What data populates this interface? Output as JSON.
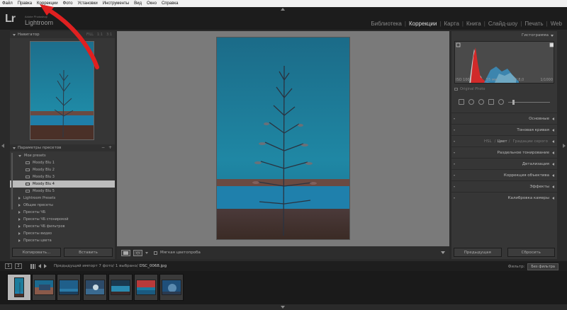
{
  "menu": [
    "Файл",
    "Правка",
    "Коррекции",
    "Фото",
    "Установки",
    "Инструменты",
    "Вид",
    "Окно",
    "Справка"
  ],
  "app": {
    "logo": "Lr",
    "subtitle": "Adobe Photoshop",
    "name": "Lightroom"
  },
  "modules": [
    "Библиотека",
    "Коррекции",
    "Карта",
    "Книга",
    "Слайд-шоу",
    "Печать",
    "Web"
  ],
  "active_module": "Коррекции",
  "navigator": {
    "title": "Навигатор",
    "zoom": [
      "FILL",
      "1:1",
      "3:1"
    ]
  },
  "presets": {
    "title": "Параметры пресетов",
    "add": "+",
    "remove": "−",
    "open_folder": "Мои presets",
    "items": [
      "Moody Blu 1",
      "Moody Blu 2",
      "Moody Blu 3",
      "Moody Blu 4",
      "Moody Blu 5"
    ],
    "selected": "Moody Blu 4",
    "folders": [
      "Lightroom Presets",
      "Общие пресеты",
      "Пресеты ЧБ",
      "Пресеты ЧБ стонирокой",
      "Пресеты ЧБ фильтров",
      "Пресеты видео",
      "Пресеты цвета"
    ]
  },
  "left_buttons": {
    "copy": "Копировать...",
    "paste": "Вставить"
  },
  "toolbar": {
    "soft_proof": "Мягкая цветопроба",
    "compare": "Y|Y"
  },
  "histogram": {
    "title": "Гистограмма",
    "iso": "ISO 100",
    "focal": "55 мм",
    "aperture": "f / 8,0",
    "shutter": "1/1000",
    "original": "Original Photo"
  },
  "sections": {
    "basic": "Основные",
    "tone_curve": "Тоновая кривая",
    "hsl": "HSL",
    "color": "Цвет",
    "gray": "Градации серого",
    "split_toning": "Раздельное тонирование",
    "detail": "Детализация",
    "lens": "Коррекция объектива",
    "effects": "Эффекты",
    "calibration": "Калибровка камеры"
  },
  "right_buttons": {
    "previous": "Предыдущая",
    "reset": "Сбросить"
  },
  "filmstrip_bar": {
    "view1": "1",
    "view2": "2",
    "source": "Предыдущий импорт",
    "count": "7 фото/",
    "selected_count": "1 выбрано/",
    "filename": "DSC_0068.jpg",
    "filter_label": "Фильтр:",
    "filter_value": "Без фильтра"
  },
  "colors": {
    "accent": "#e02020",
    "photo_sky": "#1a7fa0",
    "selected": "#bcbcbc"
  },
  "annotation": "red-arrow"
}
